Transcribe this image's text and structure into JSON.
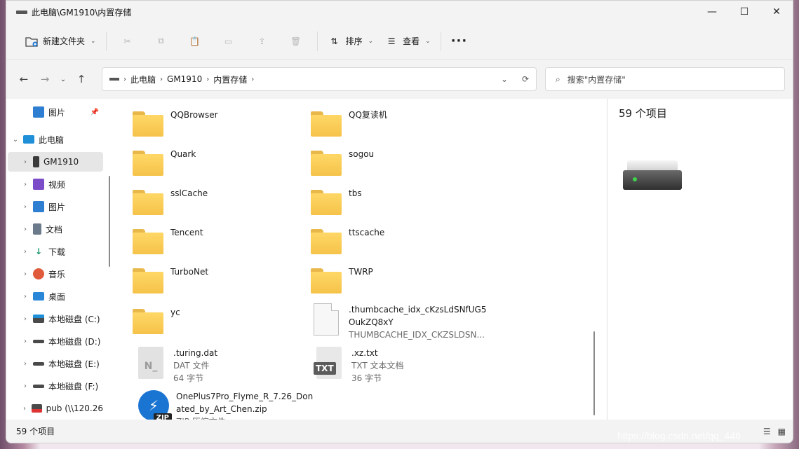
{
  "window": {
    "title": "此电脑\\GM1910\\内置存储"
  },
  "toolbar": {
    "new_folder": "新建文件夹",
    "sort": "排序",
    "view": "查看"
  },
  "address": {
    "crumbs": [
      "此电脑",
      "GM1910",
      "内置存储"
    ]
  },
  "search": {
    "placeholder": "搜索\"内置存储\""
  },
  "sidebar": {
    "items": [
      {
        "label": "图片",
        "icon": "pictures-icon",
        "color": "#2e7ed1"
      },
      {
        "label": "此电脑",
        "icon": "this-pc-icon",
        "color": "#1f8fd8"
      },
      {
        "label": "GM1910",
        "icon": "phone-icon",
        "color": "#3a3a3a"
      },
      {
        "label": "视频",
        "icon": "videos-icon",
        "color": "#7c4bc7"
      },
      {
        "label": "图片",
        "icon": "pictures-icon",
        "color": "#2e7ed1"
      },
      {
        "label": "文档",
        "icon": "documents-icon",
        "color": "#6b7b8c"
      },
      {
        "label": "下载",
        "icon": "download-icon",
        "color": "#1a9a6b"
      },
      {
        "label": "音乐",
        "icon": "music-icon",
        "color": "#e05a3c"
      },
      {
        "label": "桌面",
        "icon": "desktop-icon",
        "color": "#2a86d6"
      },
      {
        "label": "本地磁盘 (C:)",
        "icon": "windows-drive-icon",
        "color": "#4a4a4a"
      },
      {
        "label": "本地磁盘 (D:)",
        "icon": "drive-icon",
        "color": "#4a4a4a"
      },
      {
        "label": "本地磁盘 (E:)",
        "icon": "drive-icon",
        "color": "#4a4a4a"
      },
      {
        "label": "本地磁盘 (F:)",
        "icon": "drive-icon",
        "color": "#4a4a4a"
      },
      {
        "label": "pub (\\\\120.26",
        "icon": "network-drive-icon",
        "color": "#4a4a4a"
      }
    ]
  },
  "files": [
    {
      "name": "QQBrowser",
      "type": "folder"
    },
    {
      "name": "QQ复读机",
      "type": "folder"
    },
    {
      "name": "Quark",
      "type": "folder"
    },
    {
      "name": "sogou",
      "type": "folder"
    },
    {
      "name": "sslCache",
      "type": "folder"
    },
    {
      "name": "tbs",
      "type": "folder"
    },
    {
      "name": "Tencent",
      "type": "folder"
    },
    {
      "name": "ttscache",
      "type": "folder"
    },
    {
      "name": "TurboNet",
      "type": "folder"
    },
    {
      "name": "TWRP",
      "type": "folder"
    },
    {
      "name": "yc",
      "type": "folder"
    },
    {
      "name": ".thumbcache_idx_cKzsLdSNfUG5",
      "name2": "OukZQ8xY",
      "sub": "THUMBCACHE_IDX_CKZSLDSN...",
      "type": "file"
    },
    {
      "name": ".turing.dat",
      "sub": "DAT 文件",
      "sub2": "64 字节",
      "type": "dat"
    },
    {
      "name": ".xz.txt",
      "sub": "TXT 文本文档",
      "sub2": "36 字节",
      "type": "txt"
    },
    {
      "name": "OnePlus7Pro_Flyme_R_7.26_Don",
      "name2": "ated_by_Art_Chen.zip",
      "sub": "ZIP 压缩文件",
      "type": "zip"
    }
  ],
  "details": {
    "count": "59 个项目"
  },
  "status": {
    "count": "59 个项目"
  },
  "watermark": "https://blog.csdn.net/qq_446"
}
